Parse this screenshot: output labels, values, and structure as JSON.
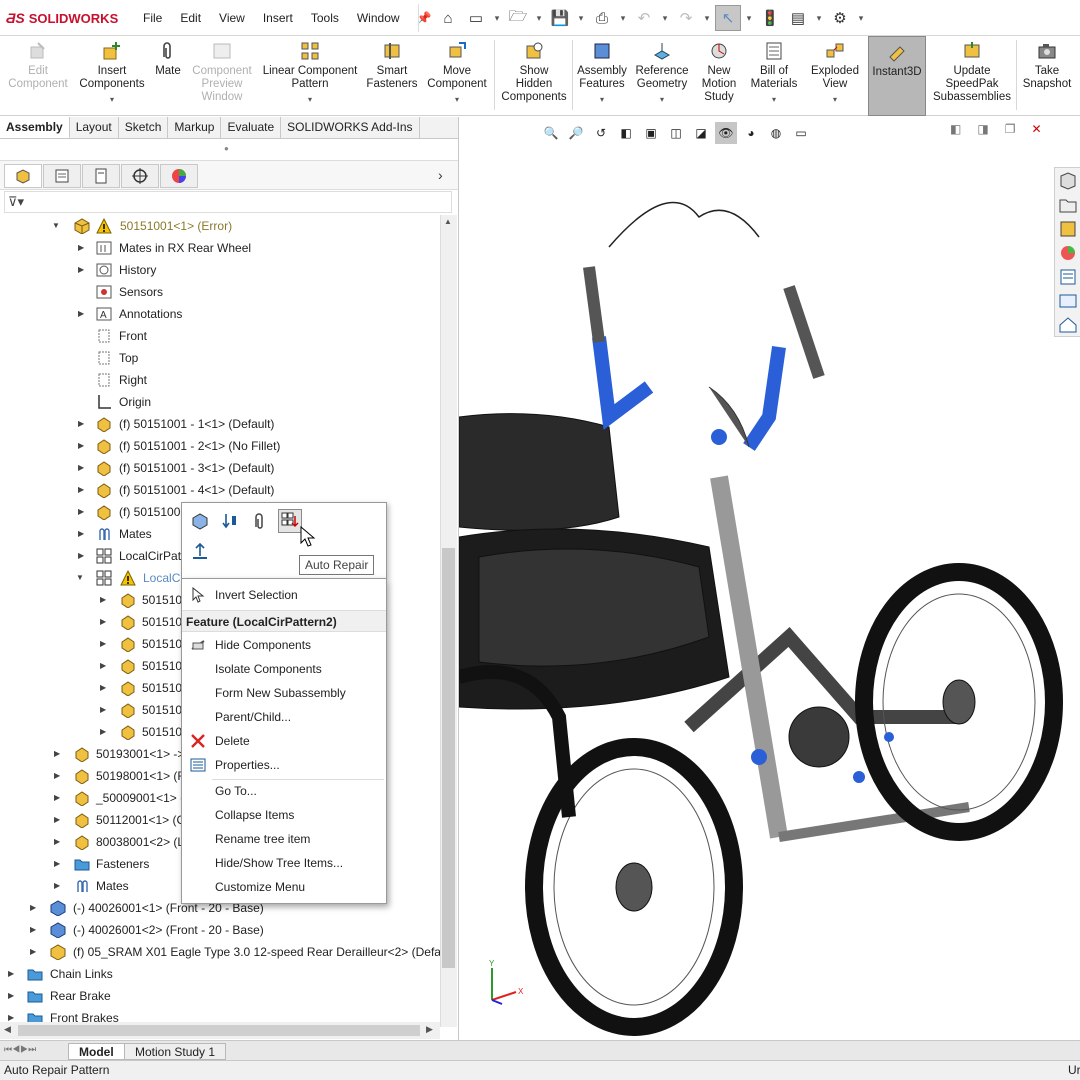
{
  "app": {
    "brand": "SOLIDWORKS",
    "brand_color": "#c8102e"
  },
  "menu": [
    "File",
    "Edit",
    "View",
    "Insert",
    "Tools",
    "Window"
  ],
  "ribbon": {
    "edit_component": "Edit\nComponent",
    "insert_components": "Insert\nComponents",
    "mate": "Mate",
    "component_preview": "Component\nPreview\nWindow",
    "linear_pattern": "Linear Component\nPattern",
    "smart_fasteners": "Smart\nFasteners",
    "move_component": "Move\nComponent",
    "show_hidden": "Show\nHidden\nComponents",
    "assembly_features": "Assembly\nFeatures",
    "reference_geometry": "Reference\nGeometry",
    "new_motion_study": "New\nMotion\nStudy",
    "bill_of_materials": "Bill of\nMaterials",
    "exploded_view": "Exploded\nView",
    "instant3d": "Instant3D",
    "update_speedpak": "Update\nSpeedPak\nSubassemblies",
    "take_snapshot": "Take\nSnapshot"
  },
  "tabs": [
    "Assembly",
    "Layout",
    "Sketch",
    "Markup",
    "Evaluate",
    "SOLIDWORKS Add-Ins"
  ],
  "tree": [
    {
      "label": "50151001<1> (Error)"
    },
    {
      "label": "Mates in RX Rear Wheel"
    },
    {
      "label": "History"
    },
    {
      "label": "Sensors"
    },
    {
      "label": "Annotations"
    },
    {
      "label": "Front"
    },
    {
      "label": "Top"
    },
    {
      "label": "Right"
    },
    {
      "label": "Origin"
    },
    {
      "label": "(f) 50151001 - 1<1> (Default)"
    },
    {
      "label": "(f) 50151001 - 2<1> (No Fillet)"
    },
    {
      "label": "(f) 50151001 - 3<1> (Default)"
    },
    {
      "label": "(f) 50151001 - 4<1> (Default)"
    },
    {
      "label": "(f) 50151001"
    },
    {
      "label": "Mates"
    },
    {
      "label": "LocalCirPatt"
    },
    {
      "label": "LocalCirPattern2"
    },
    {
      "label": "501510C"
    },
    {
      "label": "501510C"
    },
    {
      "label": "501510C"
    },
    {
      "label": "501510C"
    },
    {
      "label": "501510C"
    },
    {
      "label": "501510C"
    },
    {
      "label": "501510C"
    },
    {
      "label": "50193001<1> ->"
    },
    {
      "label": "50198001<1> (R"
    },
    {
      "label": "_50009001<1> (E"
    },
    {
      "label": "50112001<1> (C"
    },
    {
      "label": "80038001<2> (Li"
    },
    {
      "label": "Fasteners"
    },
    {
      "label": "Mates"
    },
    {
      "label": "(-) 40026001<1> (Front - 20  - Base)"
    },
    {
      "label": "(-) 40026001<2> (Front - 20  - Base)"
    },
    {
      "label": "(f) 05_SRAM X01 Eagle Type 3.0 12-speed Rear Derailleur<2> (Default)"
    },
    {
      "label": "Chain Links"
    },
    {
      "label": "Rear Brake"
    },
    {
      "label": "Front Brakes"
    }
  ],
  "context_menu": {
    "invert_selection": "Invert Selection",
    "header": "Feature (LocalCirPattern2)",
    "items": [
      "Hide Components",
      "Isolate Components",
      "Form New Subassembly",
      "Parent/Child...",
      "Delete",
      "Properties...",
      "Go To...",
      "Collapse Items",
      "Rename tree item",
      "Hide/Show Tree Items...",
      "Customize Menu"
    ]
  },
  "tooltip": "Auto Repair",
  "bottom_tabs": [
    "Model",
    "Motion Study 1"
  ],
  "status": "Auto Repair Pattern",
  "status_right": "Ur",
  "triad": {
    "x": "X",
    "y": "Y"
  },
  "colors": {
    "selected": "#5b8abf",
    "error": "#8a7a2a",
    "blue_part": "#2a5fd8"
  }
}
